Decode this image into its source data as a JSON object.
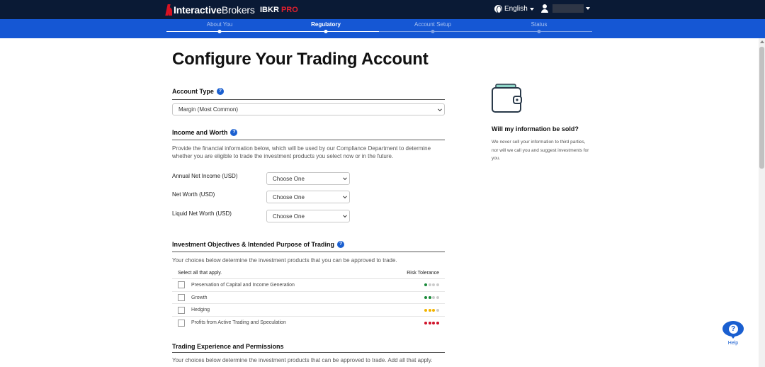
{
  "header": {
    "brand_main": "Interactive",
    "brand_rest": "Brokers",
    "product_prefix": "IBKR",
    "product_suffix": "PRO",
    "language": "English"
  },
  "steps": [
    {
      "label": "About You",
      "state": "done"
    },
    {
      "label": "Regulatory",
      "state": "active"
    },
    {
      "label": "Account Setup",
      "state": "pending"
    },
    {
      "label": "Status",
      "state": "pending"
    }
  ],
  "page": {
    "title": "Configure Your Trading Account"
  },
  "account_type": {
    "title": "Account Type",
    "selected": "Margin (Most Common)"
  },
  "income": {
    "title": "Income and Worth",
    "description": "Provide the financial information below, which will be used by our Compliance Department to determine whether you are eligible to trade the investment products you select now or in the future.",
    "fields": [
      {
        "label": "Annual Net Income (USD)",
        "value": "Choose One"
      },
      {
        "label": "Net Worth (USD)",
        "value": "Choose One"
      },
      {
        "label": "Liquid Net Worth (USD)",
        "value": "Choose One"
      }
    ]
  },
  "objectives": {
    "title": "Investment Objectives & Intended Purpose of Trading",
    "description": "Your choices below determine the investment products that you can be approved to trade.",
    "select_all_label": "Select all that apply.",
    "risk_label": "Risk Tolerance",
    "items": [
      {
        "label": "Preservation of Capital and Income Generation",
        "risk": 1,
        "color": "#1a8a3a"
      },
      {
        "label": "Growth",
        "risk": 2,
        "color": "#1a8a3a"
      },
      {
        "label": "Hedging",
        "risk": 3,
        "color": "#f2b400"
      },
      {
        "label": "Profits from Active Trading and Speculation",
        "risk": 4,
        "color": "#d0132a"
      }
    ]
  },
  "experience": {
    "title": "Trading Experience and Permissions",
    "description": "Your choices below determine the investment products that can be approved to trade. Add all that apply."
  },
  "sidebar": {
    "title": "Will my information be sold?",
    "text": "We never sell your information to third parties, nor will we call you and suggest investments for you."
  },
  "help": {
    "label": "Help"
  }
}
